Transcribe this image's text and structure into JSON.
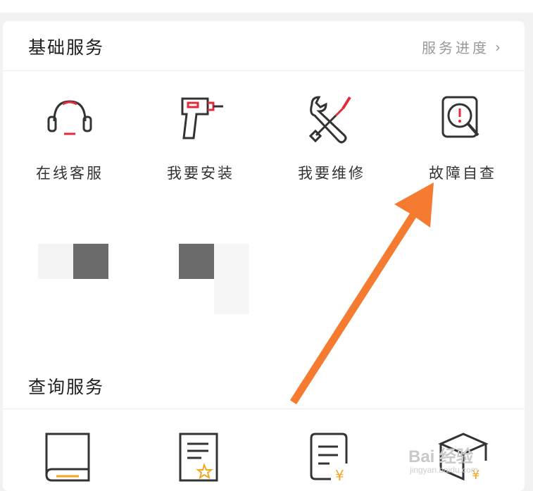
{
  "basic_services": {
    "title": "基础服务",
    "progress_link": "服务进度",
    "items": [
      {
        "label": "在线客服",
        "icon": "headset-icon"
      },
      {
        "label": "我要安装",
        "icon": "drill-icon"
      },
      {
        "label": "我要维修",
        "icon": "wrench-screwdriver-icon"
      },
      {
        "label": "故障自查",
        "icon": "diagnostic-magnifier-icon"
      }
    ]
  },
  "query_services": {
    "title": "查询服务",
    "items": [
      {
        "icon": "book-icon"
      },
      {
        "icon": "certificate-star-icon"
      },
      {
        "icon": "price-list-icon"
      },
      {
        "icon": "box-price-icon"
      }
    ]
  },
  "accent_colors": {
    "red": "#e02b3c",
    "orange": "#f5a623",
    "arrow": "#f47b30"
  },
  "watermark": {
    "text": "Bai 经验",
    "sub": "jingyan.baidu.com"
  }
}
